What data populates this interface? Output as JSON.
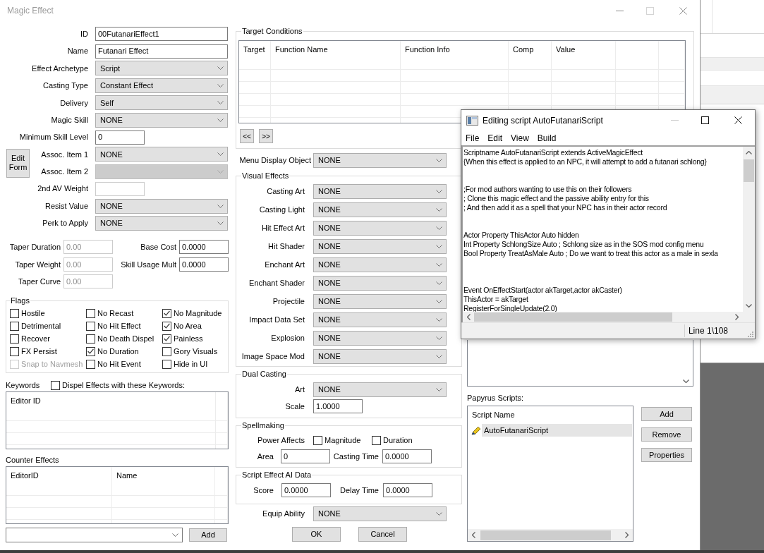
{
  "dialog": {
    "title": "Magic Effect"
  },
  "form": {
    "fields": [
      {
        "kind": "text",
        "label": "ID",
        "value": "00FutanariEffect1",
        "disabled": false
      },
      {
        "kind": "text",
        "label": "Name",
        "value": "Futanari Effect",
        "disabled": false
      },
      {
        "kind": "dropdown",
        "label": "Effect Archetype",
        "value": "Script",
        "disabled": false
      },
      {
        "kind": "dropdown",
        "label": "Casting Type",
        "value": "Constant Effect",
        "disabled": false
      },
      {
        "kind": "dropdown",
        "label": "Delivery",
        "value": "Self",
        "disabled": false
      },
      {
        "kind": "dropdown",
        "label": "Magic Skill",
        "value": "NONE",
        "disabled": false
      },
      {
        "kind": "number",
        "label": "Minimum Skill Level",
        "value": "0",
        "disabled": false
      }
    ],
    "edit_form_button": "Edit Form",
    "assoc_items": [
      {
        "kind": "dropdown",
        "label": "Assoc. Item 1",
        "value": "NONE",
        "disabled": false
      },
      {
        "kind": "dropdown",
        "label": "Assoc. Item 2",
        "disabled": true
      }
    ],
    "more_fields": [
      {
        "kind": "number",
        "label": "2nd AV Weight",
        "disabled": true
      },
      {
        "kind": "dropdown",
        "label": "Resist Value",
        "value": "NONE",
        "disabled": false
      },
      {
        "kind": "dropdown",
        "label": "Perk to Apply",
        "value": "NONE",
        "disabled": false
      }
    ],
    "taper": [
      {
        "label": "Taper Duration",
        "value": "0.00",
        "disabled": true
      },
      {
        "label": "Taper Weight",
        "value": "0.00",
        "disabled": true
      },
      {
        "label": "Taper Curve",
        "value": "0.00",
        "disabled": true
      }
    ],
    "costs": [
      {
        "label": "Base Cost",
        "value": "0.0000"
      },
      {
        "label": "Skill Usage Mult",
        "value": "0.0000"
      }
    ]
  },
  "flags": {
    "title": "Flags",
    "items": [
      {
        "label": "Hostile",
        "checked": false,
        "disabled": false
      },
      {
        "label": "No Recast",
        "checked": false,
        "disabled": false
      },
      {
        "label": "No Magnitude",
        "checked": true,
        "disabled": false
      },
      {
        "label": "Detrimental",
        "checked": false,
        "disabled": false
      },
      {
        "label": "No Hit Effect",
        "checked": false,
        "disabled": false
      },
      {
        "label": "No Area",
        "checked": true,
        "disabled": false
      },
      {
        "label": "Recover",
        "checked": false,
        "disabled": false
      },
      {
        "label": "No Death Dispel",
        "checked": false,
        "disabled": false
      },
      {
        "label": "Painless",
        "checked": true,
        "disabled": false
      },
      {
        "label": "FX Persist",
        "checked": false,
        "disabled": false
      },
      {
        "label": "No Duration",
        "checked": true,
        "disabled": false
      },
      {
        "label": "Gory Visuals",
        "checked": false,
        "disabled": false
      },
      {
        "label": "Snap to Navmesh",
        "checked": false,
        "disabled": true
      },
      {
        "label": "No Hit Event",
        "checked": false,
        "disabled": false
      },
      {
        "label": "Hide in UI",
        "checked": false,
        "disabled": false
      }
    ]
  },
  "keywords": {
    "label": "Keywords",
    "dispel": {
      "label": "Dispel Effects with these Keywords:",
      "checked": false
    },
    "columns": [
      "Editor ID"
    ]
  },
  "counter_effects": {
    "label": "Counter Effects",
    "columns": [
      "EditorID",
      "Name"
    ],
    "add_button": "Add"
  },
  "target_conditions": {
    "title": "Target Conditions",
    "columns": [
      "Target",
      "Function Name",
      "Function Info",
      "Comp",
      "Value"
    ],
    "nav_buttons": [
      "<<",
      ">>"
    ]
  },
  "menu_display_object": {
    "label": "Menu Display Object",
    "value": "NONE"
  },
  "visual_effects": {
    "title": "Visual Effects",
    "rows": [
      {
        "label": "Casting Art",
        "value": "NONE"
      },
      {
        "label": "Casting Light",
        "value": "NONE"
      },
      {
        "label": "Hit Effect Art",
        "value": "NONE"
      },
      {
        "label": "Hit Shader",
        "value": "NONE"
      },
      {
        "label": "Enchant Art",
        "value": "NONE"
      },
      {
        "label": "Enchant Shader",
        "value": "NONE"
      },
      {
        "label": "Projectile",
        "value": "NONE"
      },
      {
        "label": "Impact Data Set",
        "value": "NONE"
      },
      {
        "label": "Explosion",
        "value": "NONE"
      },
      {
        "label": "Image Space Mod",
        "value": "NONE"
      }
    ]
  },
  "dual_casting": {
    "title": "Dual Casting",
    "art": {
      "label": "Art",
      "value": "NONE"
    },
    "scale": {
      "label": "Scale",
      "value": "1.0000"
    }
  },
  "spellmaking": {
    "title": "Spellmaking",
    "power_affects": {
      "label": "Power Affects",
      "options": [
        {
          "label": "Magnitude",
          "checked": false
        },
        {
          "label": "Duration",
          "checked": false
        }
      ]
    },
    "area": {
      "label": "Area",
      "value": "0"
    },
    "casting_time": {
      "label": "Casting Time",
      "value": "0.0000"
    }
  },
  "script_effect_ai_data": {
    "title": "Script Effect AI Data",
    "score": {
      "label": "Score",
      "value": "0.0000"
    },
    "delay_time": {
      "label": "Delay Time",
      "value": "0.0000"
    }
  },
  "equip_ability": {
    "label": "Equip Ability",
    "value": "NONE"
  },
  "dialog_buttons": [
    "OK",
    "Cancel"
  ],
  "papyrus_scripts": {
    "label": "Papyrus Scripts:",
    "columns": [
      "Script Name"
    ],
    "rows": [
      {
        "name": "AutoFutanariScript",
        "selected": true
      }
    ],
    "buttons": [
      "Add",
      "Remove",
      "Properties"
    ]
  },
  "script_editor": {
    "title": "Editing script AutoFutanariScript",
    "menu": [
      "File",
      "Edit",
      "View",
      "Build"
    ],
    "text": "Scriptname AutoFutanariScript extends ActiveMagicEffect\n{When this effect is applied to an NPC, it will attempt to add a futanari schlong}\n\n\n;For mod authors wanting to use this on their followers\n; Clone this magic effect and the passive ability entry for this\n; And then add it as a spell that your NPC has in their actor record\n\n\nActor Property ThisActor Auto hidden\nInt Property SchlongSize Auto ; Schlong size as in the SOS mod config menu\nBool Property TreatAsMale Auto ; Do we want to treat this actor as a male in sexla\n\n\n\nEvent OnEffectStart(actor akTarget,actor akCaster)\nThisActor = akTarget\nRegisterForSingleUpdate(2.0)",
    "status": "Line 1\\108"
  }
}
